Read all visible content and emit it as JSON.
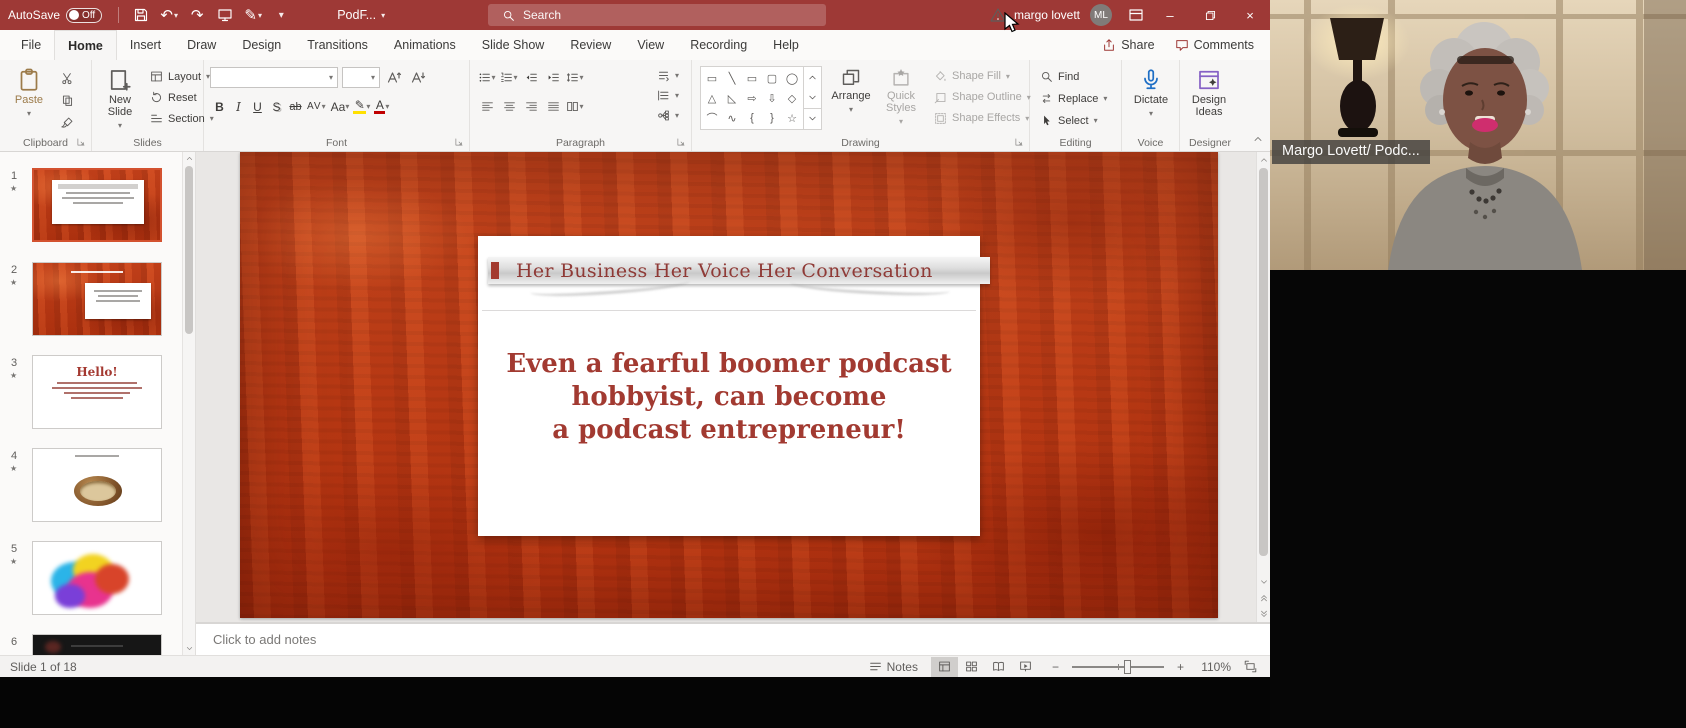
{
  "titlebar": {
    "autosave_label": "AutoSave",
    "autosave_state": "Off",
    "doc_title": "PodF...",
    "search_placeholder": "Search",
    "account_name": "margo lovett",
    "account_initials": "ML"
  },
  "icons": {
    "undo": "↶",
    "redo": "↷",
    "pen": "✎",
    "dropdown": "▾",
    "minimize": "–",
    "close": "×",
    "animation_star": "★",
    "zoom_out": "−",
    "zoom_in": "+"
  },
  "ribbon": {
    "tabs": [
      "File",
      "Home",
      "Insert",
      "Draw",
      "Design",
      "Transitions",
      "Animations",
      "Slide Show",
      "Review",
      "View",
      "Recording",
      "Help"
    ],
    "active_tab": "Home",
    "share_label": "Share",
    "comments_label": "Comments",
    "clipboard": {
      "label": "Clipboard",
      "paste": "Paste"
    },
    "slides": {
      "label": "Slides",
      "new_slide": "New Slide",
      "layout": "Layout",
      "reset": "Reset",
      "section": "Section"
    },
    "font": {
      "label": "Font",
      "font_name": "",
      "font_size": "",
      "bold": "B",
      "italic": "I",
      "underline": "U",
      "shadow": "S",
      "strike": "ab",
      "spacing": "AV",
      "case": "Aa",
      "color_letter": "A"
    },
    "paragraph": {
      "label": "Paragraph"
    },
    "drawing": {
      "label": "Drawing",
      "arrange": "Arrange",
      "quick_styles": "Quick Styles",
      "shape_fill": "Shape Fill",
      "shape_outline": "Shape Outline",
      "shape_effects": "Shape Effects",
      "shapes": [
        "▭",
        "╲",
        "▭",
        "▢",
        "◯",
        "△",
        "◺",
        "⇨",
        "⇩",
        "◇",
        "⌒",
        "∿",
        "{",
        "}",
        "☆"
      ]
    },
    "editing": {
      "label": "Editing",
      "find": "Find",
      "replace": "Replace",
      "select": "Select"
    },
    "voice": {
      "label": "Voice",
      "dictate": "Dictate"
    },
    "designer": {
      "label": "Designer",
      "design_ideas": "Design Ideas"
    }
  },
  "slides_panel": {
    "slides": [
      {
        "number": "1"
      },
      {
        "number": "2"
      },
      {
        "number": "3",
        "text": "Hello!"
      },
      {
        "number": "4"
      },
      {
        "number": "5"
      },
      {
        "number": "6"
      }
    ]
  },
  "slide": {
    "title": "Her Business Her Voice Her Conversation",
    "body_lines": [
      "Even a fearful boomer podcast",
      "hobbyist, can become",
      "a podcast entrepreneur!"
    ]
  },
  "notes_pane": {
    "placeholder": "Click to add notes"
  },
  "statusbar": {
    "slide_indicator": "Slide 1 of 18",
    "notes_label": "Notes",
    "zoom_level": "110%"
  },
  "webcam": {
    "caption": "Margo Lovett/ Podc..."
  },
  "colors": {
    "titlebar_red": "#9e3936",
    "slide_red": "#c23d1e",
    "slide_text_red": "#9e3a33",
    "selection_orange": "#d35230",
    "dictate_blue": "#1f6fc5"
  }
}
